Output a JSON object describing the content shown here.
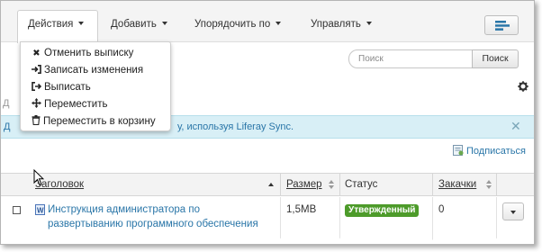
{
  "toolbar": {
    "actions_label": "Действия",
    "add_label": "Добавить",
    "sort_label": "Упорядочить по",
    "manage_label": "Управлять"
  },
  "dropdown": {
    "items": [
      {
        "icon": "close-icon",
        "label": "Отменить выписку"
      },
      {
        "icon": "sign-in-icon",
        "label": "Записать изменения"
      },
      {
        "icon": "sign-out-icon",
        "label": "Выписать"
      },
      {
        "icon": "move-icon",
        "label": "Переместить"
      },
      {
        "icon": "trash-icon",
        "label": "Переместить в корзину"
      }
    ]
  },
  "search": {
    "placeholder": "Поиск",
    "button_label": "Поиск"
  },
  "partial_label": "Д",
  "info": {
    "lead": "Д",
    "text": "у, используя Liferay Sync."
  },
  "subscribe_label": "Подписаться",
  "table": {
    "headers": {
      "title": "Заголовок",
      "size": "Размер",
      "status": "Статус",
      "downloads": "Закачки"
    },
    "rows": [
      {
        "title": "Инструкция администратора по развертыванию программного обеспечения",
        "size": "1,5MB",
        "status": "Утвержденный",
        "downloads": "0"
      }
    ]
  },
  "colors": {
    "link": "#2a76a8",
    "info_bg": "#d8eff6",
    "status_approved": "#4d9b2a",
    "toggle_icon": "#2a76a8"
  }
}
